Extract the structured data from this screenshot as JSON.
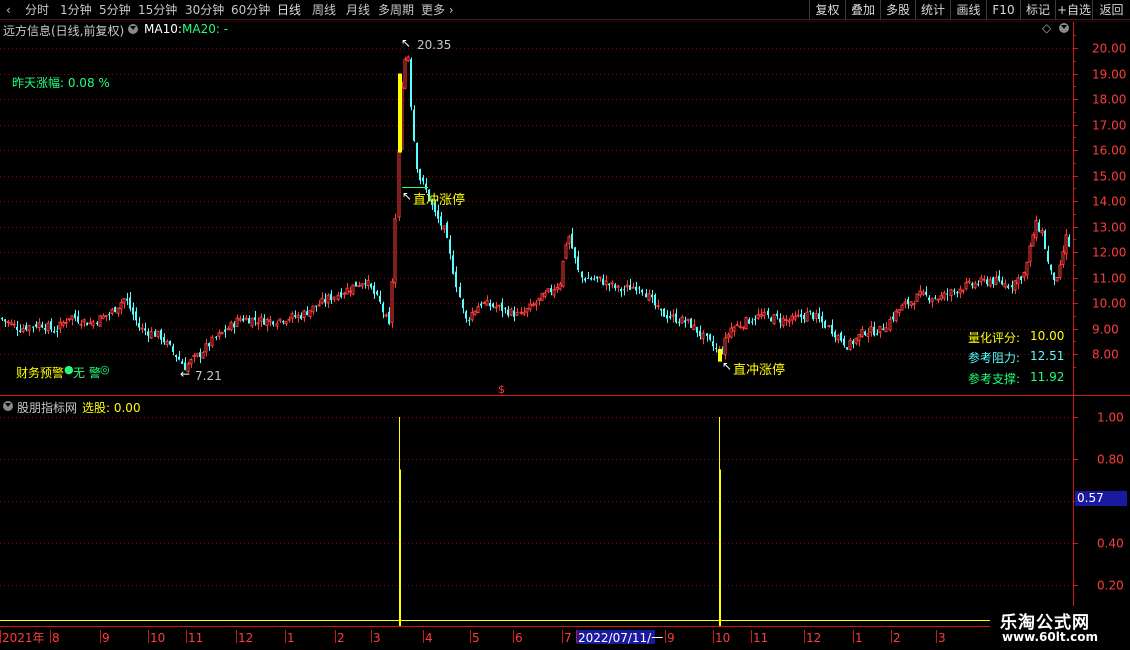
{
  "toolbar": {
    "timeframes": [
      "分时",
      "1分钟",
      "5分钟",
      "15分钟",
      "30分钟",
      "60分钟",
      "日线",
      "周线",
      "月线",
      "多周期",
      "更多"
    ],
    "active_timeframe": "日线",
    "right_buttons": [
      "复权",
      "叠加",
      "多股",
      "统计",
      "画线",
      "F10",
      "标记",
      "+自选",
      "返回"
    ]
  },
  "main_panel": {
    "title": "远方信息(日线,前复权)",
    "ma10_label": "MA10:",
    "ma20_label": "MA20: -",
    "yesterday_change": "昨天涨幅: 0.08 %",
    "finance_alert": "财务预警",
    "finance_alert_value": "无 警",
    "high_annotation": "20.35",
    "low_annotation": "7.21",
    "limit_up_label_1": "直冲涨停",
    "limit_up_label_2": "直冲涨停",
    "score_label": "量化评分:",
    "score_value": "10.00",
    "resistance_label": "参考阻力:",
    "resistance_value": "12.51",
    "support_label": "参考支撑:",
    "support_value": "11.92",
    "dollar_marker": "$"
  },
  "sub_panel": {
    "title": "股朋指标网",
    "select_label": "选股: 0.00",
    "current_value_box": "0.57"
  },
  "time_axis": {
    "labels": [
      "2021年",
      "8",
      "9",
      "10",
      "11",
      "12",
      "1",
      "2",
      "3",
      "4",
      "5",
      "6",
      "7",
      "2022/07/11/一",
      "9",
      "10",
      "11",
      "12",
      "1",
      "2",
      "3"
    ]
  },
  "watermark": {
    "line1": "乐淘公式网",
    "line2": "www.60lt.com"
  },
  "colors": {
    "up": "#ff3c3c",
    "down": "#54ffff",
    "grid": "#8b0000",
    "signal": "#ffff00",
    "axis_text": "#ff3c3c"
  },
  "chart_data": [
    {
      "type": "candlestick",
      "title": "远方信息(日线,前复权)",
      "ylim": [
        7.0,
        20.6
      ],
      "y_ticks": [
        8.0,
        9.0,
        10.0,
        11.0,
        12.0,
        13.0,
        14.0,
        15.0,
        16.0,
        17.0,
        18.0,
        19.0,
        20.0
      ],
      "highest": 20.35,
      "lowest": 7.21,
      "close_path": [
        {
          "x": 0,
          "y": 9.4
        },
        {
          "x": 20,
          "y": 9.0
        },
        {
          "x": 40,
          "y": 9.2
        },
        {
          "x": 55,
          "y": 8.9
        },
        {
          "x": 70,
          "y": 9.5
        },
        {
          "x": 90,
          "y": 9.2
        },
        {
          "x": 110,
          "y": 9.6
        },
        {
          "x": 125,
          "y": 10.2
        },
        {
          "x": 140,
          "y": 9.0
        },
        {
          "x": 160,
          "y": 8.7
        },
        {
          "x": 185,
          "y": 7.5
        },
        {
          "x": 200,
          "y": 8.0
        },
        {
          "x": 215,
          "y": 8.6
        },
        {
          "x": 240,
          "y": 9.4
        },
        {
          "x": 270,
          "y": 9.3
        },
        {
          "x": 300,
          "y": 9.5
        },
        {
          "x": 330,
          "y": 10.2
        },
        {
          "x": 350,
          "y": 10.6
        },
        {
          "x": 365,
          "y": 10.9
        },
        {
          "x": 380,
          "y": 10.0
        },
        {
          "x": 390,
          "y": 9.0
        },
        {
          "x": 397,
          "y": 14.5
        },
        {
          "x": 402,
          "y": 19.0
        },
        {
          "x": 407,
          "y": 20.1
        },
        {
          "x": 412,
          "y": 17.0
        },
        {
          "x": 418,
          "y": 15.0
        },
        {
          "x": 425,
          "y": 14.5
        },
        {
          "x": 435,
          "y": 13.5
        },
        {
          "x": 445,
          "y": 12.8
        },
        {
          "x": 455,
          "y": 11.0
        },
        {
          "x": 465,
          "y": 9.3
        },
        {
          "x": 480,
          "y": 10.0
        },
        {
          "x": 500,
          "y": 9.8
        },
        {
          "x": 520,
          "y": 9.5
        },
        {
          "x": 545,
          "y": 10.3
        },
        {
          "x": 560,
          "y": 10.8
        },
        {
          "x": 568,
          "y": 12.8
        },
        {
          "x": 580,
          "y": 11.0
        },
        {
          "x": 600,
          "y": 10.9
        },
        {
          "x": 620,
          "y": 10.5
        },
        {
          "x": 640,
          "y": 10.7
        },
        {
          "x": 660,
          "y": 9.6
        },
        {
          "x": 690,
          "y": 9.2
        },
        {
          "x": 705,
          "y": 8.6
        },
        {
          "x": 720,
          "y": 8.0
        },
        {
          "x": 730,
          "y": 9.0
        },
        {
          "x": 760,
          "y": 9.5
        },
        {
          "x": 790,
          "y": 9.3
        },
        {
          "x": 810,
          "y": 9.6
        },
        {
          "x": 830,
          "y": 9.0
        },
        {
          "x": 848,
          "y": 8.3
        },
        {
          "x": 865,
          "y": 8.9
        },
        {
          "x": 880,
          "y": 8.9
        },
        {
          "x": 900,
          "y": 9.8
        },
        {
          "x": 920,
          "y": 10.3
        },
        {
          "x": 940,
          "y": 10.2
        },
        {
          "x": 960,
          "y": 10.6
        },
        {
          "x": 990,
          "y": 10.9
        },
        {
          "x": 1010,
          "y": 10.7
        },
        {
          "x": 1025,
          "y": 11.2
        },
        {
          "x": 1035,
          "y": 13.1
        },
        {
          "x": 1042,
          "y": 12.8
        },
        {
          "x": 1050,
          "y": 11.2
        },
        {
          "x": 1058,
          "y": 10.8
        },
        {
          "x": 1066,
          "y": 12.6
        },
        {
          "x": 1072,
          "y": 12.0
        }
      ]
    },
    {
      "type": "bar",
      "title": "股朋指标网",
      "ylim": [
        0.1,
        1.08
      ],
      "y_ticks": [
        0.2,
        0.4,
        0.57,
        0.8,
        1.0
      ],
      "signals": [
        {
          "x_label": "2021/03",
          "value": 1.0
        },
        {
          "x_label": "2021/10",
          "value": 1.0
        }
      ]
    }
  ]
}
